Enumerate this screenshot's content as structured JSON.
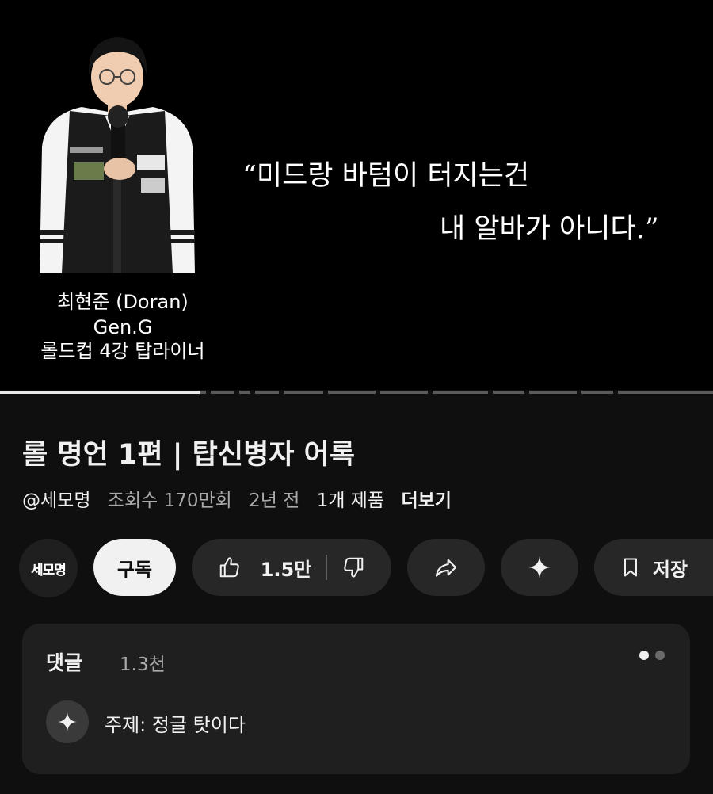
{
  "video": {
    "quote_line1": "“미드랑 바텀이 터지는건",
    "quote_line2": "내 알바가 아니다.”",
    "caption_name": "최현준 (Doran)",
    "caption_team": "Gen.G",
    "caption_role": "롤드컵 4강 탑라이너",
    "progress_fraction": 0.28
  },
  "info": {
    "title": "롤 명언 1편 | 탑신병자 어록",
    "channel": "@세모명",
    "views": "조회수 170만회",
    "age": "2년 전",
    "products": "1개 제품",
    "more": "더보기"
  },
  "actions": {
    "channel_avatar_text": "세모명",
    "subscribe": "구독",
    "likes": "1.5만",
    "save": "저장",
    "icons": [
      "thumbs-up-icon",
      "thumbs-down-icon",
      "share-icon",
      "sparkle-icon",
      "bookmark-icon"
    ]
  },
  "comments": {
    "header": "댓글",
    "count": "1.3천",
    "topic": "주제: 정글 탓이다",
    "icons": [
      "sparkle-icon"
    ]
  },
  "colors": {
    "background": "#0f0f0f",
    "pill": "#272727",
    "subscribe_bg": "#f1f1f1",
    "panel": "#1f1f1f"
  }
}
